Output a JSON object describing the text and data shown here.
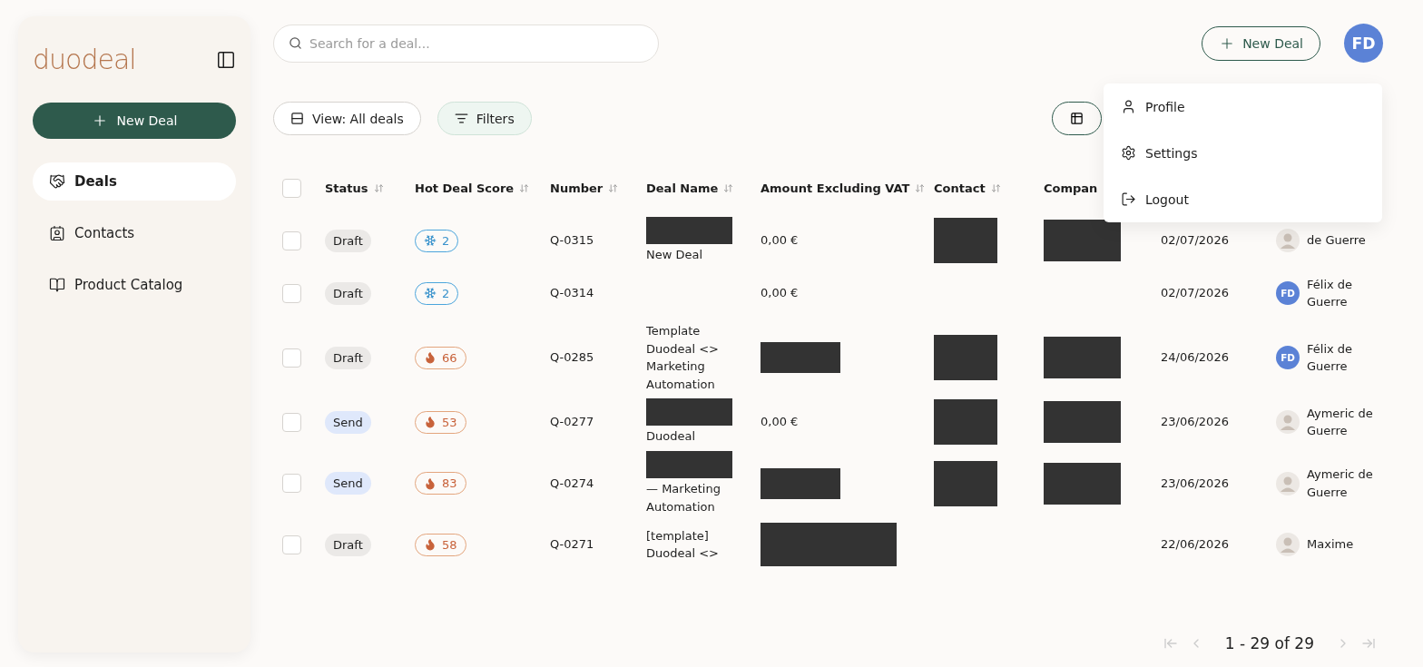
{
  "sidebar": {
    "logo": "duodeal",
    "new_deal": "New Deal",
    "nav": [
      {
        "label": "Deals",
        "selected": true
      },
      {
        "label": "Contacts",
        "selected": false
      },
      {
        "label": "Product Catalog",
        "selected": false
      }
    ]
  },
  "search": {
    "placeholder": "Search for a deal..."
  },
  "header": {
    "new_deal": "New Deal",
    "avatar": "FD"
  },
  "toolbar": {
    "view": "View: All deals",
    "filters": "Filters"
  },
  "user_menu": [
    {
      "label": "Profile"
    },
    {
      "label": "Settings"
    },
    {
      "label": "Logout"
    }
  ],
  "table": {
    "select_all": {
      "checked": false
    },
    "columns": [
      {
        "label": "Status",
        "sortable": true
      },
      {
        "label": "Hot Deal Score",
        "sortable": true
      },
      {
        "label": "Number",
        "sortable": true
      },
      {
        "label": "Deal Name",
        "sortable": true
      },
      {
        "label": "Amount Excluding VAT",
        "sortable": true
      },
      {
        "label": "Contact",
        "sortable": true
      },
      {
        "label": "Compan",
        "sortable": false
      }
    ],
    "rows": [
      {
        "checked": false,
        "status": {
          "label": "Draft",
          "kind": "draft"
        },
        "score": {
          "value": "2",
          "kind": "cold"
        },
        "number": "Q-0315",
        "deal_name": {
          "text": "New Deal",
          "redacted": true
        },
        "amount": {
          "text": "0,00 €"
        },
        "contact_redacted": true,
        "company_redacted": true,
        "date": "02/07/2026",
        "owner": {
          "name": "de Guerre",
          "kind": "photo"
        }
      },
      {
        "checked": false,
        "status": {
          "label": "Draft",
          "kind": "draft"
        },
        "score": {
          "value": "2",
          "kind": "cold"
        },
        "number": "Q-0314",
        "amount": {
          "text": "0,00 €"
        },
        "date": "02/07/2026",
        "owner": {
          "name": "Félix de Guerre",
          "kind": "initials",
          "initials": "FD"
        }
      },
      {
        "checked": false,
        "status": {
          "label": "Draft",
          "kind": "draft"
        },
        "score": {
          "value": "66",
          "kind": "hot"
        },
        "number": "Q-0285",
        "deal_name": {
          "text": "Template Duodeal <> Marketing Automation"
        },
        "amount": {
          "redacted": true
        },
        "contact_redacted": true,
        "company_redacted": true,
        "date": "24/06/2026",
        "owner": {
          "name": "Félix de Guerre",
          "kind": "initials",
          "initials": "FD"
        }
      },
      {
        "checked": false,
        "status": {
          "label": "Send",
          "kind": "send"
        },
        "score": {
          "value": "53",
          "kind": "hot"
        },
        "number": "Q-0277",
        "deal_name": {
          "text": "Duodeal",
          "redacted": true
        },
        "amount": {
          "text": "0,00 €"
        },
        "contact_redacted": true,
        "company_redacted": true,
        "date": "23/06/2026",
        "owner": {
          "name": "Aymeric de Guerre",
          "kind": "photo"
        }
      },
      {
        "checked": false,
        "status": {
          "label": "Send",
          "kind": "send"
        },
        "score": {
          "value": "83",
          "kind": "hot"
        },
        "number": "Q-0274",
        "deal_name": {
          "text": "— Marketing Automation",
          "redacted": true
        },
        "amount": {
          "redacted": true
        },
        "contact_redacted": true,
        "company_redacted": true,
        "date": "23/06/2026",
        "owner": {
          "name": "Aymeric de Guerre",
          "kind": "photo"
        }
      },
      {
        "checked": false,
        "status": {
          "label": "Draft",
          "kind": "draft"
        },
        "score": {
          "value": "58",
          "kind": "hot"
        },
        "number": "Q-0271",
        "deal_name": {
          "text": "[template] Duodeal <>"
        },
        "amount": {
          "redacted": true
        },
        "date": "22/06/2026",
        "owner": {
          "name": "Maxime",
          "kind": "photo"
        }
      }
    ]
  },
  "pagination": {
    "label": "1 - 29 of 29"
  }
}
